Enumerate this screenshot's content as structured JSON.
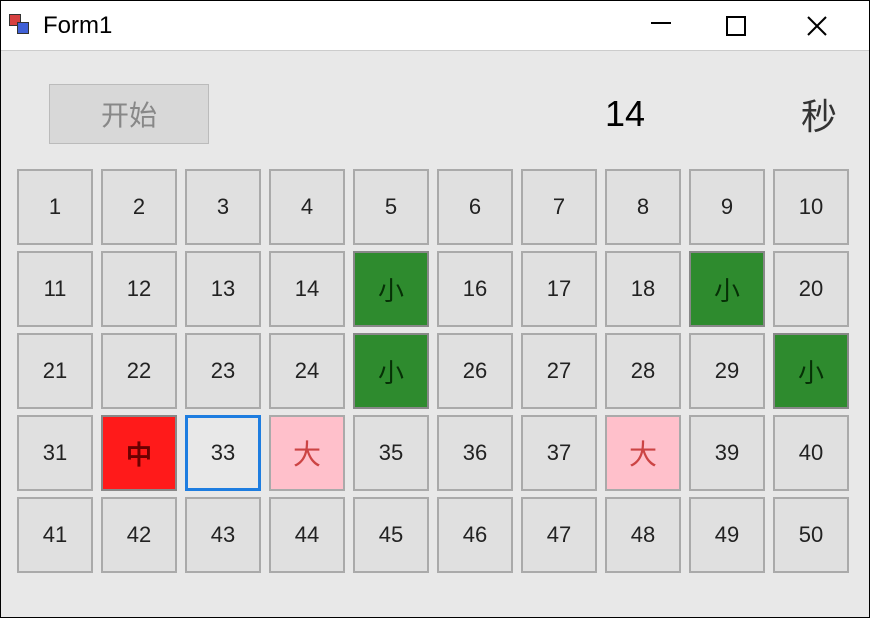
{
  "window": {
    "title": "Form1"
  },
  "controls": {
    "start_label": "开始",
    "counter_value": "14",
    "seconds_label": "秒"
  },
  "cells": [
    {
      "label": "1",
      "style": "normal"
    },
    {
      "label": "2",
      "style": "normal"
    },
    {
      "label": "3",
      "style": "normal"
    },
    {
      "label": "4",
      "style": "normal"
    },
    {
      "label": "5",
      "style": "normal"
    },
    {
      "label": "6",
      "style": "normal"
    },
    {
      "label": "7",
      "style": "normal"
    },
    {
      "label": "8",
      "style": "normal"
    },
    {
      "label": "9",
      "style": "normal"
    },
    {
      "label": "10",
      "style": "normal"
    },
    {
      "label": "11",
      "style": "normal"
    },
    {
      "label": "12",
      "style": "normal"
    },
    {
      "label": "13",
      "style": "normal"
    },
    {
      "label": "14",
      "style": "normal"
    },
    {
      "label": "小",
      "style": "green"
    },
    {
      "label": "16",
      "style": "normal"
    },
    {
      "label": "17",
      "style": "normal"
    },
    {
      "label": "18",
      "style": "normal"
    },
    {
      "label": "小",
      "style": "green"
    },
    {
      "label": "20",
      "style": "normal"
    },
    {
      "label": "21",
      "style": "normal"
    },
    {
      "label": "22",
      "style": "normal"
    },
    {
      "label": "23",
      "style": "normal"
    },
    {
      "label": "24",
      "style": "normal"
    },
    {
      "label": "小",
      "style": "green"
    },
    {
      "label": "26",
      "style": "normal"
    },
    {
      "label": "27",
      "style": "normal"
    },
    {
      "label": "28",
      "style": "normal"
    },
    {
      "label": "29",
      "style": "normal"
    },
    {
      "label": "小",
      "style": "green"
    },
    {
      "label": "31",
      "style": "normal"
    },
    {
      "label": "中",
      "style": "red"
    },
    {
      "label": "33",
      "style": "blue-border"
    },
    {
      "label": "大",
      "style": "pink"
    },
    {
      "label": "35",
      "style": "normal"
    },
    {
      "label": "36",
      "style": "normal"
    },
    {
      "label": "37",
      "style": "normal"
    },
    {
      "label": "大",
      "style": "pink"
    },
    {
      "label": "39",
      "style": "normal"
    },
    {
      "label": "40",
      "style": "normal"
    },
    {
      "label": "41",
      "style": "normal"
    },
    {
      "label": "42",
      "style": "normal"
    },
    {
      "label": "43",
      "style": "normal"
    },
    {
      "label": "44",
      "style": "normal"
    },
    {
      "label": "45",
      "style": "normal"
    },
    {
      "label": "46",
      "style": "normal"
    },
    {
      "label": "47",
      "style": "normal"
    },
    {
      "label": "48",
      "style": "normal"
    },
    {
      "label": "49",
      "style": "normal"
    },
    {
      "label": "50",
      "style": "normal"
    }
  ]
}
